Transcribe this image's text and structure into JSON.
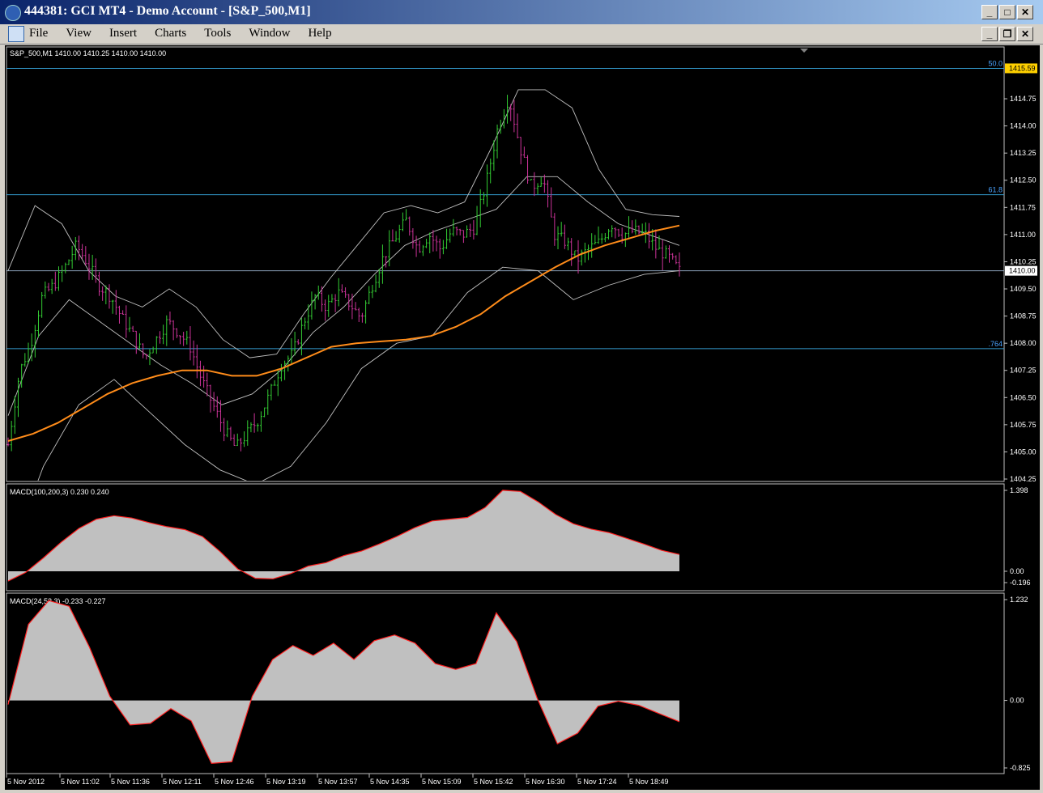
{
  "window": {
    "title": "444381: GCI MT4 - Demo Account - [S&P_500,M1]",
    "controls": [
      "_",
      "□",
      "✕"
    ]
  },
  "menu": {
    "items": [
      "File",
      "View",
      "Insert",
      "Charts",
      "Tools",
      "Window",
      "Help"
    ],
    "mdi_controls": [
      "_",
      "❐",
      "✕"
    ]
  },
  "chart_data": [
    {
      "type": "line",
      "title": "S&P_500,M1  1410.00 1410.25 1410.00 1410.00",
      "y_ticks": [
        "1414.75",
        "1414.00",
        "1413.25",
        "1412.50",
        "1411.75",
        "1411.00",
        "1410.25",
        "1409.50",
        "1408.75",
        "1408.00",
        "1407.25",
        "1406.50",
        "1405.75",
        "1405.00",
        "1404.25"
      ],
      "ylim": [
        1404.25,
        1415.6
      ],
      "fib_levels": [
        {
          "label": "50.0",
          "price": 1415.59
        },
        {
          "label": "61.8",
          "price": 1412.1
        },
        {
          "label": ".764",
          "price": 1407.85
        }
      ],
      "price_tag_high": "1415.59",
      "price_tag_current": "1410.00",
      "current_price_line": 1410.0,
      "close": [
        1405.2,
        1407.2,
        1408.0,
        1409.3,
        1409.6,
        1410.1,
        1410.7,
        1410.2,
        1409.6,
        1409.3,
        1408.7,
        1408.2,
        1407.6,
        1408.1,
        1408.6,
        1408.3,
        1407.9,
        1407.0,
        1406.3,
        1405.6,
        1405.1,
        1405.5,
        1405.9,
        1406.6,
        1407.4,
        1407.7,
        1408.6,
        1409.3,
        1409.0,
        1409.4,
        1409.1,
        1408.7,
        1409.6,
        1410.4,
        1410.9,
        1411.4,
        1410.6,
        1411.0,
        1410.6,
        1411.1,
        1411.0,
        1411.2,
        1412.4,
        1413.9,
        1414.8,
        1413.4,
        1412.3,
        1412.6,
        1411.0,
        1410.8,
        1410.3,
        1410.6,
        1410.8,
        1411.3,
        1411.0,
        1411.1,
        1411.0,
        1410.6,
        1410.4,
        1410.0
      ],
      "ma_orange": [
        1405.3,
        1405.5,
        1405.8,
        1406.2,
        1406.6,
        1406.9,
        1407.1,
        1407.25,
        1407.25,
        1407.1,
        1407.1,
        1407.3,
        1407.6,
        1407.9,
        1408.0,
        1408.05,
        1408.1,
        1408.2,
        1408.45,
        1408.8,
        1409.3,
        1409.7,
        1410.1,
        1410.45,
        1410.7,
        1410.9,
        1411.1,
        1411.25
      ],
      "bb_upper": [
        1410.0,
        1411.8,
        1411.3,
        1410.0,
        1409.3,
        1409.0,
        1409.5,
        1409.0,
        1408.1,
        1407.6,
        1407.7,
        1408.8,
        1409.8,
        1410.7,
        1411.6,
        1411.8,
        1411.6,
        1411.9,
        1413.4,
        1415.0,
        1415.0,
        1414.5,
        1412.8,
        1411.7,
        1411.55,
        1411.5
      ],
      "bb_middle": [
        1406.0,
        1408.2,
        1409.2,
        1408.6,
        1408.0,
        1407.4,
        1406.9,
        1406.3,
        1406.6,
        1407.3,
        1408.3,
        1409.0,
        1409.9,
        1410.7,
        1411.1,
        1411.4,
        1411.7,
        1412.6,
        1412.6,
        1411.9,
        1411.3,
        1411.0,
        1410.7
      ],
      "bb_lower": [
        1402.0,
        1404.6,
        1406.3,
        1407.0,
        1406.1,
        1405.2,
        1404.5,
        1404.1,
        1404.6,
        1405.8,
        1407.3,
        1408.0,
        1408.2,
        1409.4,
        1410.1,
        1410.0,
        1409.2,
        1409.6,
        1409.9,
        1410.0
      ]
    },
    {
      "type": "area",
      "title": "MACD(100,200,3) 0.230 0.240",
      "y_ticks": [
        "1.398",
        "0.00",
        "-0.196"
      ],
      "ylim": [
        -0.196,
        1.398
      ],
      "values": [
        -0.17,
        -0.02,
        0.23,
        0.5,
        0.74,
        0.9,
        0.96,
        0.92,
        0.84,
        0.77,
        0.72,
        0.6,
        0.34,
        0.04,
        -0.12,
        -0.13,
        -0.04,
        0.09,
        0.15,
        0.27,
        0.35,
        0.47,
        0.6,
        0.75,
        0.87,
        0.9,
        0.93,
        1.1,
        1.4,
        1.38,
        1.2,
        0.98,
        0.82,
        0.73,
        0.67,
        0.57,
        0.47,
        0.36,
        0.29
      ]
    },
    {
      "type": "area",
      "title": "MACD(24,52,3) -0.233 -0.227",
      "y_ticks": [
        "1.232",
        "0.00",
        "-0.825"
      ],
      "ylim": [
        -0.825,
        1.232
      ],
      "values": [
        -0.05,
        0.93,
        1.22,
        1.15,
        0.65,
        0.05,
        -0.3,
        -0.28,
        -0.1,
        -0.25,
        -0.77,
        -0.75,
        0.05,
        0.5,
        0.67,
        0.55,
        0.7,
        0.5,
        0.73,
        0.8,
        0.7,
        0.45,
        0.38,
        0.45,
        1.07,
        0.72,
        0.03,
        -0.53,
        -0.4,
        -0.07,
        -0.01,
        -0.06,
        -0.16,
        -0.26
      ]
    }
  ],
  "time_axis": [
    "5 Nov 2012",
    "5 Nov 11:02",
    "5 Nov 11:36",
    "5 Nov 12:11",
    "5 Nov 12:46",
    "5 Nov 13:19",
    "5 Nov 13:57",
    "5 Nov 14:35",
    "5 Nov 15:09",
    "5 Nov 15:42",
    "5 Nov 16:30",
    "5 Nov 17:24",
    "5 Nov 18:49"
  ],
  "colors": {
    "bull": "#33cc33",
    "bear": "#cc3399",
    "ma": "#ff8c1a",
    "bands": "#c0c0c0",
    "fib": "#3399cc",
    "macd_fill": "#c0c0c0",
    "macd_line": "#ff2020",
    "price_tag": "#ffd000"
  }
}
